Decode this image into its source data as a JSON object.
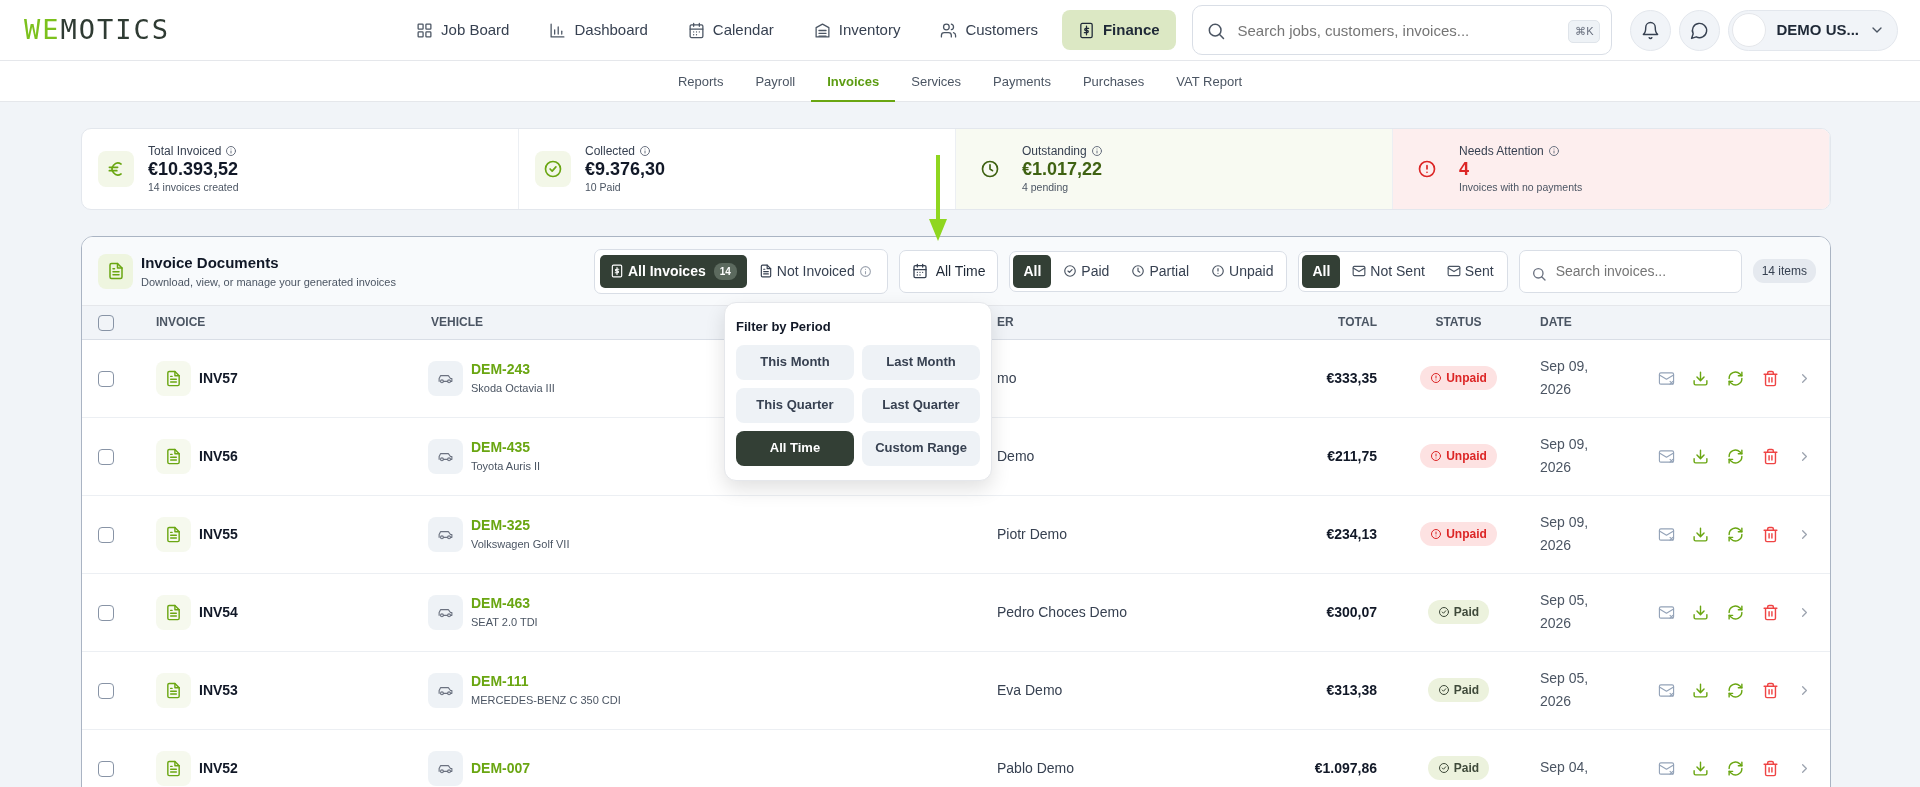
{
  "logo": {
    "accent": "WE",
    "rest": "MOTICS"
  },
  "main_nav": [
    {
      "label": "Job Board",
      "selected": false
    },
    {
      "label": "Dashboard",
      "selected": false
    },
    {
      "label": "Calendar",
      "selected": false
    },
    {
      "label": "Inventory",
      "selected": false
    },
    {
      "label": "Customers",
      "selected": false
    },
    {
      "label": "Finance",
      "selected": true
    }
  ],
  "search": {
    "placeholder": "Search jobs, customers, invoices...",
    "shortcut": "⌘K"
  },
  "user": {
    "name": "DEMO US..."
  },
  "sub_nav": [
    {
      "label": "Reports",
      "selected": false
    },
    {
      "label": "Payroll",
      "selected": false
    },
    {
      "label": "Invoices",
      "selected": true
    },
    {
      "label": "Services",
      "selected": false
    },
    {
      "label": "Payments",
      "selected": false
    },
    {
      "label": "Purchases",
      "selected": false
    },
    {
      "label": "VAT Report",
      "selected": false
    }
  ],
  "stats": [
    {
      "kind": "default",
      "label": "Total Invoiced",
      "value": "€10.393,52",
      "note": "14 invoices created"
    },
    {
      "kind": "default",
      "label": "Collected",
      "value": "€9.376,30",
      "note": "10 Paid"
    },
    {
      "kind": "outstanding",
      "label": "Outstanding",
      "value": "€1.017,22",
      "note": "4 pending"
    },
    {
      "kind": "attention",
      "label": "Needs Attention",
      "value": "4",
      "note": "Invoices with no payments"
    }
  ],
  "panel": {
    "title": "Invoice Documents",
    "subtitle": "Download, view, or manage your generated invoices"
  },
  "type_filter": [
    {
      "label": "All Invoices",
      "count": "14",
      "selected": true
    },
    {
      "label": "Not Invoiced",
      "selected": false
    }
  ],
  "period_button": {
    "label": "All Time"
  },
  "status_filter": [
    {
      "label": "All",
      "selected": true
    },
    {
      "label": "Paid",
      "selected": false
    },
    {
      "label": "Partial",
      "selected": false
    },
    {
      "label": "Unpaid",
      "selected": false
    }
  ],
  "sent_filter": [
    {
      "label": "All",
      "selected": true
    },
    {
      "label": "Not Sent",
      "selected": false
    },
    {
      "label": "Sent",
      "selected": false
    }
  ],
  "table_search": {
    "placeholder": "Search invoices..."
  },
  "items_count": "14 items",
  "period_menu": {
    "title": "Filter by Period",
    "options": [
      {
        "label": "This Month",
        "selected": false
      },
      {
        "label": "Last Month",
        "selected": false
      },
      {
        "label": "This Quarter",
        "selected": false
      },
      {
        "label": "Last Quarter",
        "selected": false
      },
      {
        "label": "All Time",
        "selected": true
      },
      {
        "label": "Custom Range",
        "selected": false
      }
    ]
  },
  "table": {
    "header_checked": false,
    "columns": [
      "INVOICE",
      "VEHICLE",
      "ER",
      "TOTAL",
      "STATUS",
      "DATE"
    ],
    "rows": [
      {
        "checked": false,
        "invoice": "INV57",
        "plate": "DEM-243",
        "model": "Skoda Octavia III",
        "customer": "mo",
        "total": "€333,35",
        "status": {
          "kind": "unpaid",
          "label": "Unpaid"
        },
        "date": "Sep 09, 2026"
      },
      {
        "checked": false,
        "invoice": "INV56",
        "plate": "DEM-435",
        "model": "Toyota Auris II",
        "customer": "Demo",
        "total": "€211,75",
        "status": {
          "kind": "unpaid",
          "label": "Unpaid"
        },
        "date": "Sep 09, 2026"
      },
      {
        "checked": false,
        "invoice": "INV55",
        "plate": "DEM-325",
        "model": "Volkswagen Golf VII",
        "customer": "Piotr Demo",
        "total": "€234,13",
        "status": {
          "kind": "unpaid",
          "label": "Unpaid"
        },
        "date": "Sep 09, 2026"
      },
      {
        "checked": false,
        "invoice": "INV54",
        "plate": "DEM-463",
        "model": "SEAT 2.0 TDI",
        "customer": "Pedro Choces Demo",
        "total": "€300,07",
        "status": {
          "kind": "paid",
          "label": "Paid"
        },
        "date": "Sep 05, 2026"
      },
      {
        "checked": false,
        "invoice": "INV53",
        "plate": "DEM-111",
        "model": "MERCEDES-BENZ C 350 CDI",
        "customer": "Eva Demo",
        "total": "€313,38",
        "status": {
          "kind": "paid",
          "label": "Paid"
        },
        "date": "Sep 05, 2026"
      },
      {
        "checked": false,
        "invoice": "INV52",
        "plate": "DEM-007",
        "customer": "Pablo Demo",
        "total": "€1.097,86",
        "status": {
          "kind": "paid",
          "label": "Paid"
        },
        "date": "Sep 04,"
      }
    ]
  }
}
